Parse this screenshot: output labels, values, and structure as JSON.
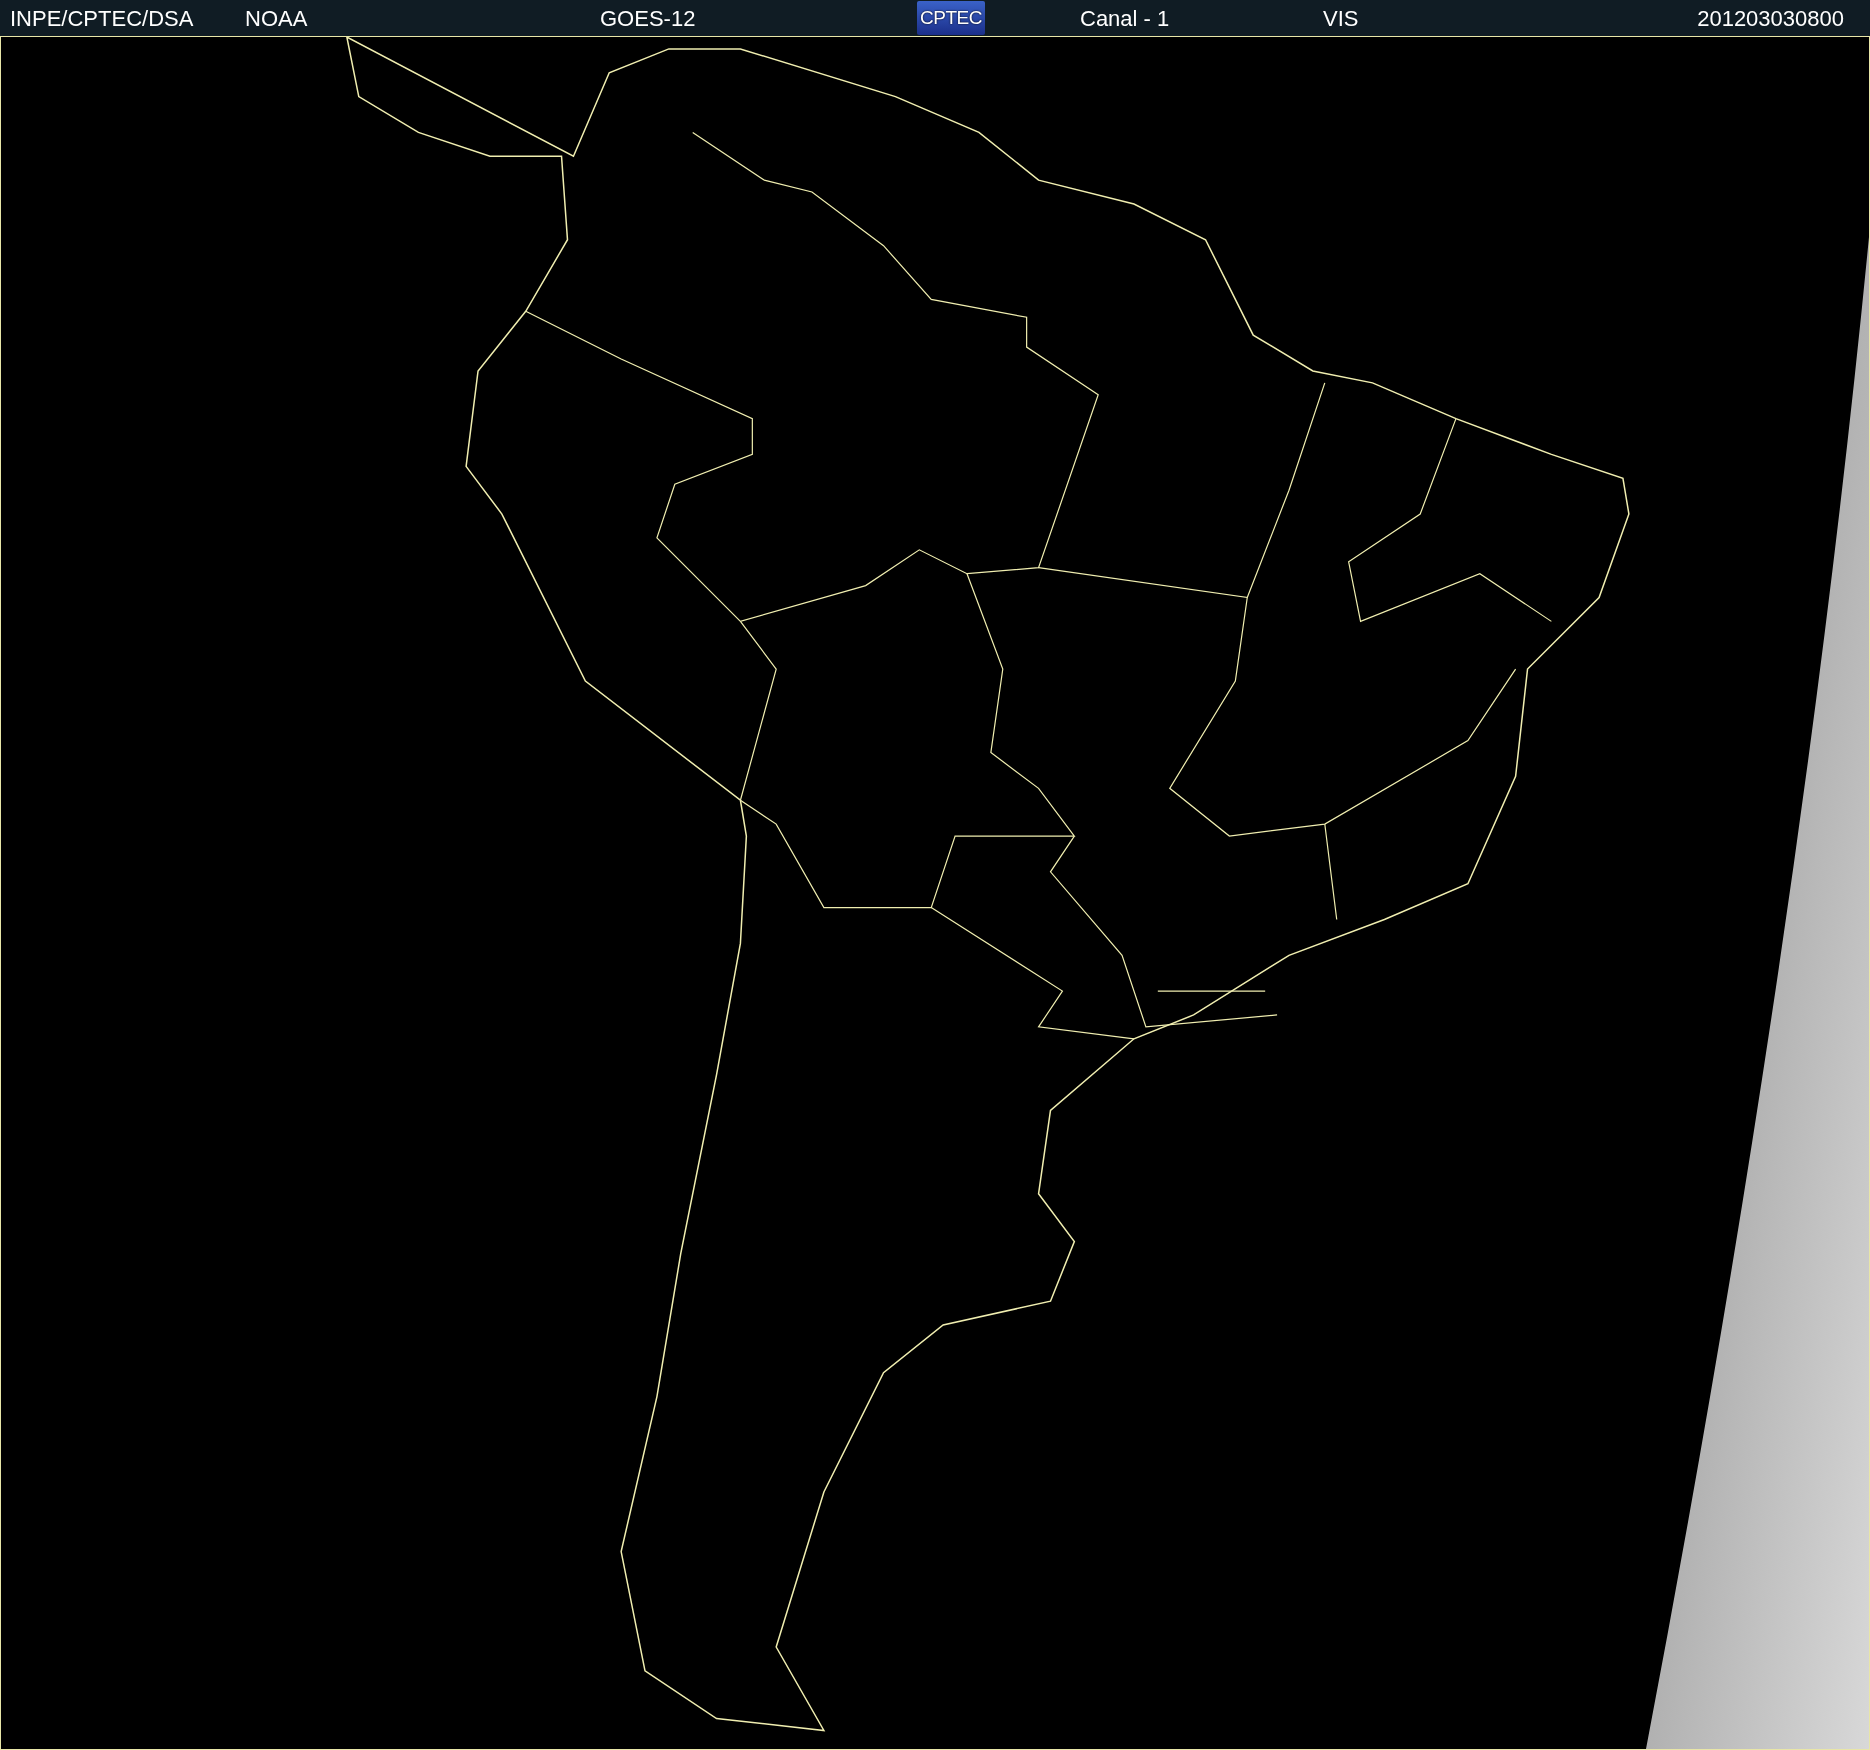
{
  "header": {
    "source": "INPE/CPTEC/DSA",
    "agency": "NOAA",
    "satellite": "GOES-12",
    "logo": {
      "text": "CPTEC"
    },
    "channel": "Canal - 1",
    "band": "VIS",
    "timestamp": "201203030800"
  }
}
